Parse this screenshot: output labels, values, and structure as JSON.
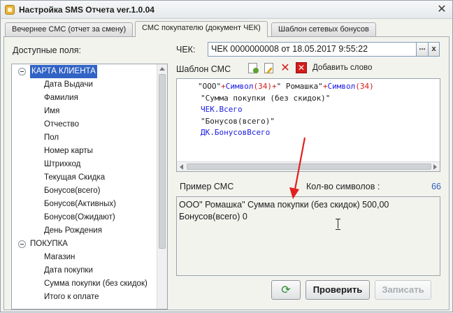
{
  "window": {
    "title": "Настройка SMS Отчета ver.1.0.04",
    "close_glyph": "✕"
  },
  "tabs": [
    {
      "label": "Вечернее СМС (отчет за смену)",
      "active": false
    },
    {
      "label": "СМС покупателю (документ ЧЕК)",
      "active": true
    },
    {
      "label": "Шаблон сетевых бонусов",
      "active": false
    }
  ],
  "fields_panel": {
    "label": "Доступные поля:",
    "groups": [
      {
        "label": "КАРТА КЛИЕНТА",
        "selected": true,
        "items": [
          "Дата Выдачи",
          "Фамилия",
          "Имя",
          "Отчество",
          "Пол",
          "Номер карты",
          "Штрихкод",
          "Текущая Скидка",
          "Бонусов(всего)",
          "Бонусов(Активных)",
          "Бонусов(Ожидают)",
          "День Рождения"
        ]
      },
      {
        "label": "ПОКУПКА",
        "selected": false,
        "items": [
          "Магазин",
          "Дата покупки",
          "Сумма покупки (без скидок)",
          "Итого к оплате"
        ]
      }
    ]
  },
  "check_field": {
    "label": "ЧЕК:",
    "value": "ЧЕК 0000000008 от 18.05.2017 9:55:22",
    "select_glyph": "...",
    "clear_glyph": "x"
  },
  "template": {
    "label": "Шаблон СМС",
    "add_word_label": "Добавить слово",
    "delete_glyph": "✕",
    "delete_all_glyph": "✕",
    "lines": [
      [
        {
          "t": "\"ООО\"",
          "k": "str"
        },
        {
          "t": "+",
          "k": "op"
        },
        {
          "t": "Символ",
          "k": "fn"
        },
        {
          "t": "(34)",
          "k": "op"
        },
        {
          "t": "+",
          "k": "op"
        },
        {
          "t": "\" Ромашка\"",
          "k": "str"
        },
        {
          "t": "+",
          "k": "op"
        },
        {
          "t": "Символ",
          "k": "fn"
        },
        {
          "t": "(34)",
          "k": "op"
        }
      ],
      [
        {
          "t": "\"Сумма покупки (без скидок)\"",
          "k": "str"
        }
      ],
      [
        {
          "t": "ЧЕК.Всего",
          "k": "fn"
        }
      ],
      [
        {
          "t": "\"Бонусов(всего)\"",
          "k": "str"
        }
      ],
      [
        {
          "t": "ДК.БонусовВсего",
          "k": "fn"
        }
      ]
    ]
  },
  "preview": {
    "label": "Пример СМС",
    "count_label": "Кол-во символов :",
    "count_value": "66",
    "lines": [
      "ООО\" Ромашка\" Сумма покупки (без скидок)  500,00",
      "Бонусов(всего)  0"
    ]
  },
  "buttons": {
    "refresh_glyph": "⟳",
    "check_label": "Проверить",
    "save_label": "Записать"
  },
  "colors": {
    "operator": "#d61a1a",
    "function": "#1a1ae0",
    "selection": "#3163c5",
    "annotation_arrow": "#e3201e"
  }
}
